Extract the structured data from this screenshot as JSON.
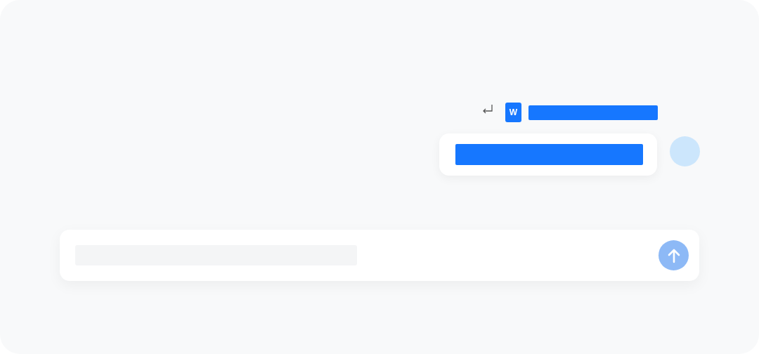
{
  "message": {
    "attachment": {
      "file_badge": "W"
    }
  }
}
